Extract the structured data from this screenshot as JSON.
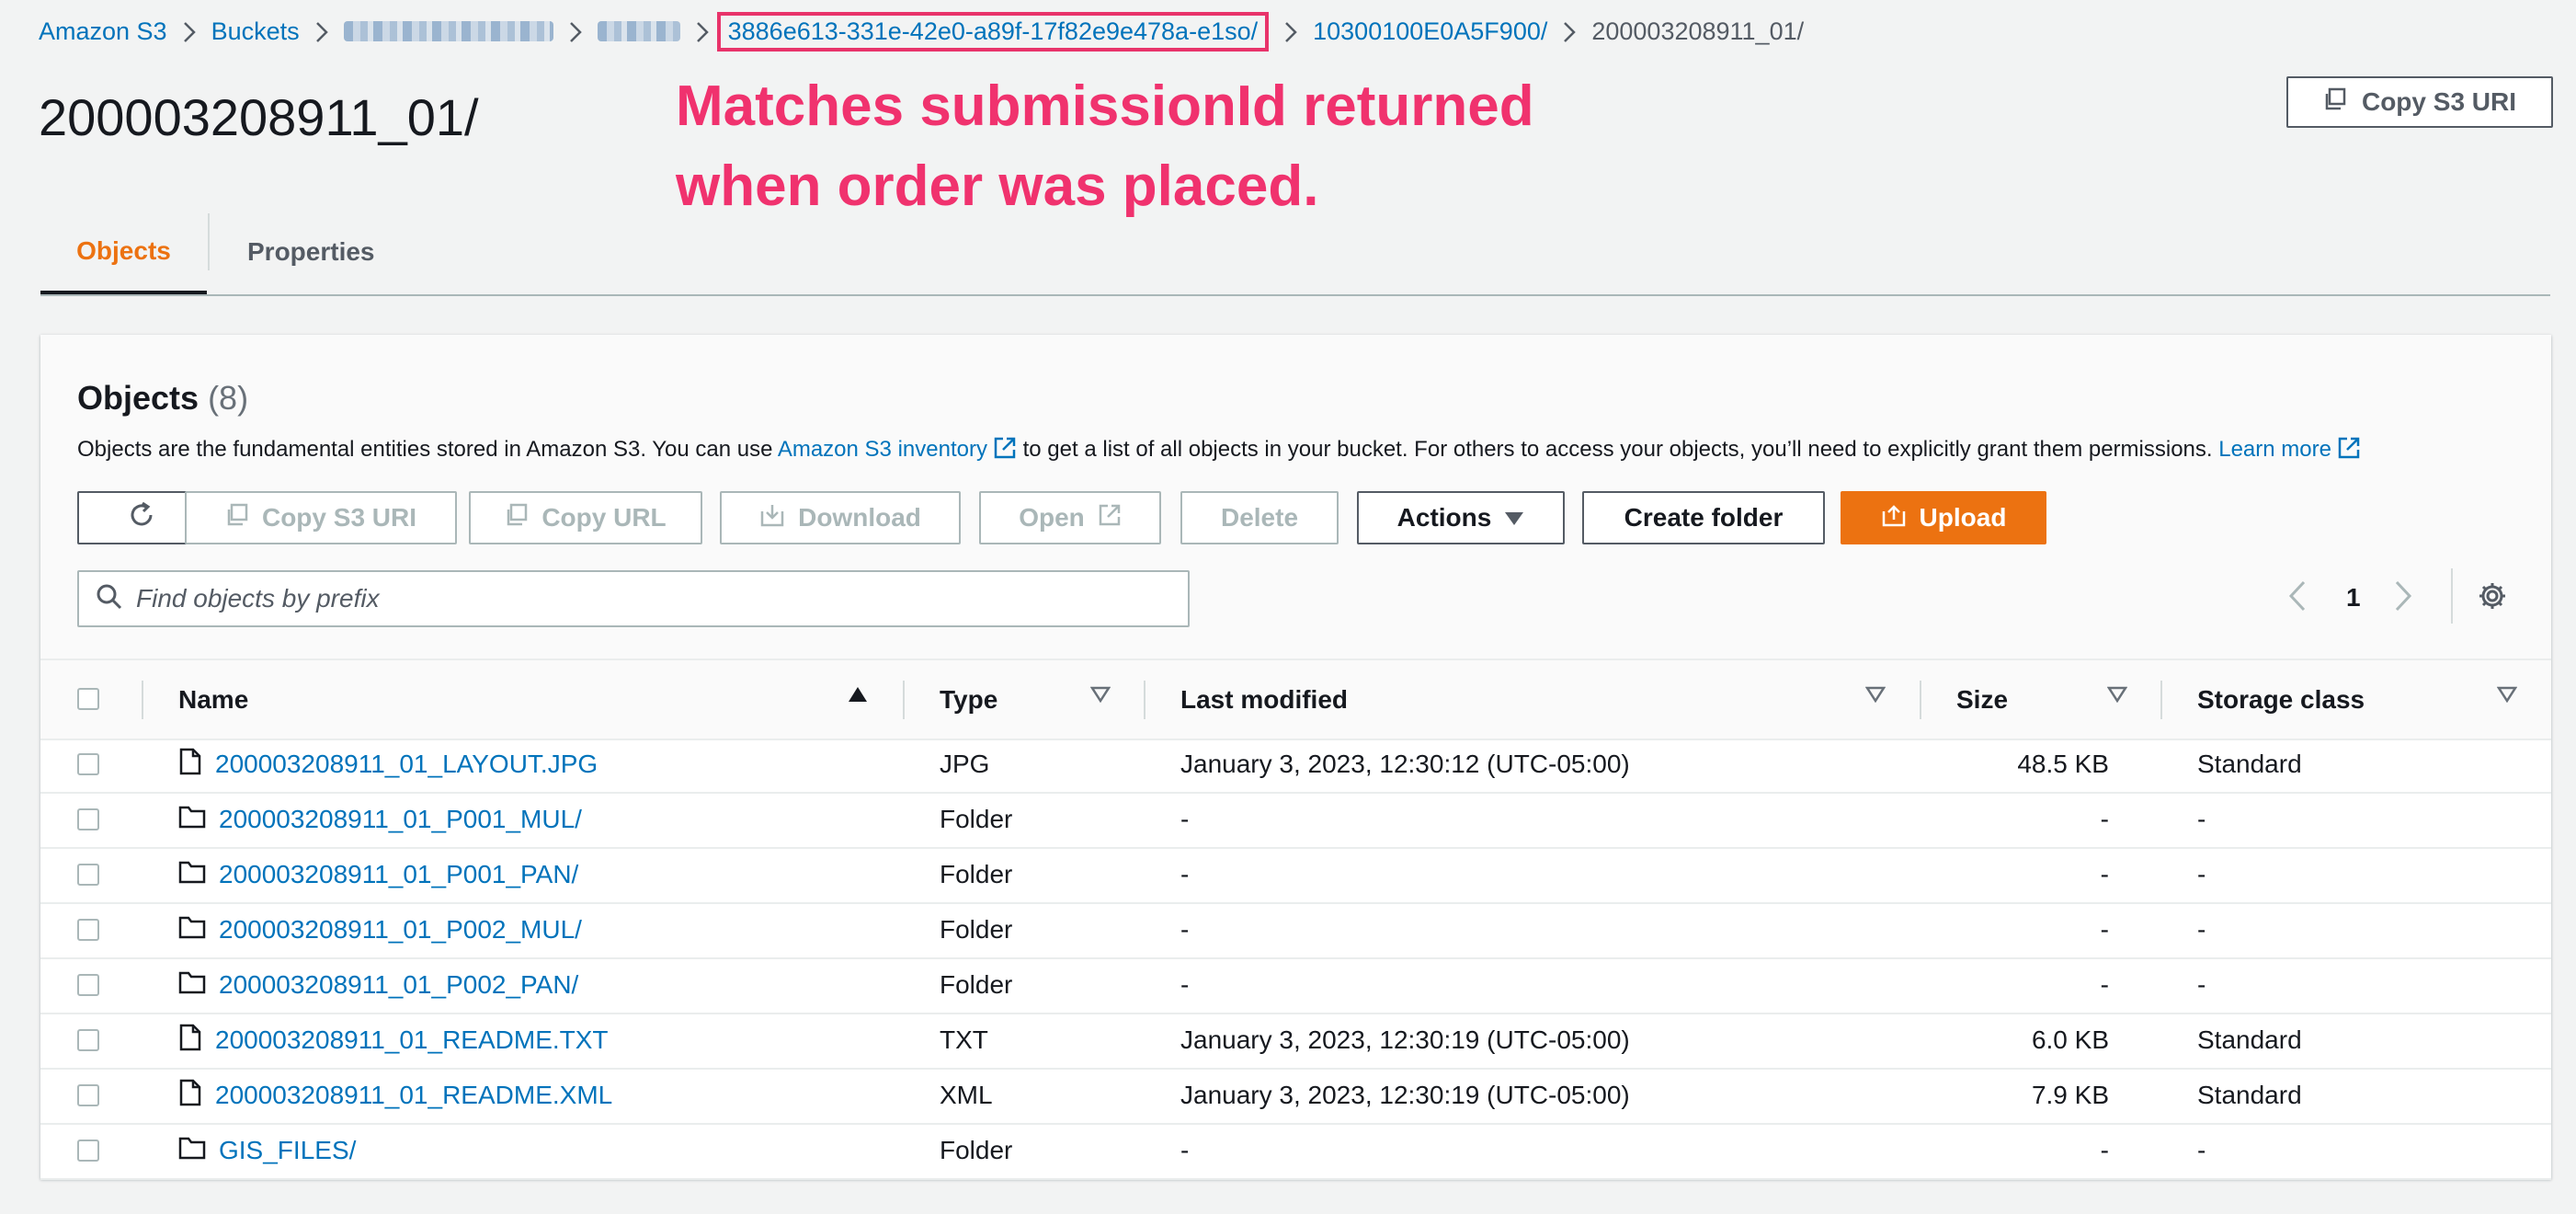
{
  "breadcrumb": {
    "items": [
      "Amazon S3",
      "Buckets"
    ],
    "highlighted": "3886e613-331e-42e0-a89f-17f82e9e478a-e1so/",
    "after": "10300100E0A5F900/",
    "current": "200003208911_01/"
  },
  "header": {
    "title": "200003208911_01/",
    "copy_uri_label": "Copy S3 URI"
  },
  "annotation": {
    "line1": "Matches submissionId returned",
    "line2": "when order was placed."
  },
  "tabs": [
    "Objects",
    "Properties"
  ],
  "objects_panel": {
    "title": "Objects",
    "count": "(8)",
    "desc_before": "Objects are the fundamental entities stored in Amazon S3. You can use",
    "inventory_link": "Amazon S3 inventory",
    "desc_middle": "to get a list of all objects in your bucket. For others to access your objects, you’ll need to explicitly grant them permissions.",
    "learn_more": "Learn more",
    "buttons": {
      "copy_s3_uri": "Copy S3 URI",
      "copy_url": "Copy URL",
      "download": "Download",
      "open": "Open",
      "delete": "Delete",
      "actions": "Actions",
      "create_folder": "Create folder",
      "upload": "Upload"
    },
    "search_placeholder": "Find objects by prefix",
    "page_number": "1"
  },
  "table": {
    "columns": [
      "Name",
      "Type",
      "Last modified",
      "Size",
      "Storage class"
    ],
    "rows": [
      {
        "name": "200003208911_01_LAYOUT.JPG",
        "icon": "file-icon",
        "type": "JPG",
        "modified": "January 3, 2023, 12:30:12 (UTC-05:00)",
        "size": "48.5 KB",
        "storage": "Standard"
      },
      {
        "name": "200003208911_01_P001_MUL/",
        "icon": "folder-icon",
        "type": "Folder",
        "modified": "-",
        "size": "-",
        "storage": "-"
      },
      {
        "name": "200003208911_01_P001_PAN/",
        "icon": "folder-icon",
        "type": "Folder",
        "modified": "-",
        "size": "-",
        "storage": "-"
      },
      {
        "name": "200003208911_01_P002_MUL/",
        "icon": "folder-icon",
        "type": "Folder",
        "modified": "-",
        "size": "-",
        "storage": "-"
      },
      {
        "name": "200003208911_01_P002_PAN/",
        "icon": "folder-icon",
        "type": "Folder",
        "modified": "-",
        "size": "-",
        "storage": "-"
      },
      {
        "name": "200003208911_01_README.TXT",
        "icon": "file-icon",
        "type": "TXT",
        "modified": "January 3, 2023, 12:30:19 (UTC-05:00)",
        "size": "6.0 KB",
        "storage": "Standard"
      },
      {
        "name": "200003208911_01_README.XML",
        "icon": "file-icon",
        "type": "XML",
        "modified": "January 3, 2023, 12:30:19 (UTC-05:00)",
        "size": "7.9 KB",
        "storage": "Standard"
      },
      {
        "name": "GIS_FILES/",
        "icon": "folder-icon",
        "type": "Folder",
        "modified": "-",
        "size": "-",
        "storage": "-"
      }
    ]
  },
  "colors": {
    "link": "#0073bb",
    "accent_orange": "#ec7211",
    "annotation_pink": "#f0326e"
  }
}
